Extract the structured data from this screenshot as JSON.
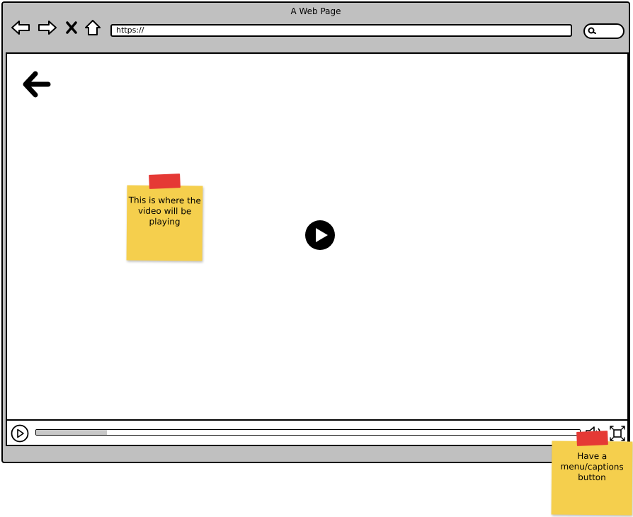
{
  "window": {
    "title": "A Web Page",
    "address": "https://"
  },
  "icons": {
    "back": "arrow-left-icon",
    "forward": "arrow-right-icon",
    "stop": "close-icon",
    "home": "home-icon",
    "search": "search-icon",
    "page_back": "back-arrow-icon",
    "play": "play-icon",
    "volume": "volume-icon",
    "fullscreen": "fullscreen-icon"
  },
  "player": {
    "progress_fraction": 0.13
  },
  "notes": {
    "video_note": "This is where the video will be playing",
    "menu_note": "Have a menu/captions button"
  },
  "colors": {
    "chrome": "#c0c0c0",
    "sticky": "#f5cf4d",
    "tape": "#e53935",
    "progress": "#c8c8c8"
  }
}
